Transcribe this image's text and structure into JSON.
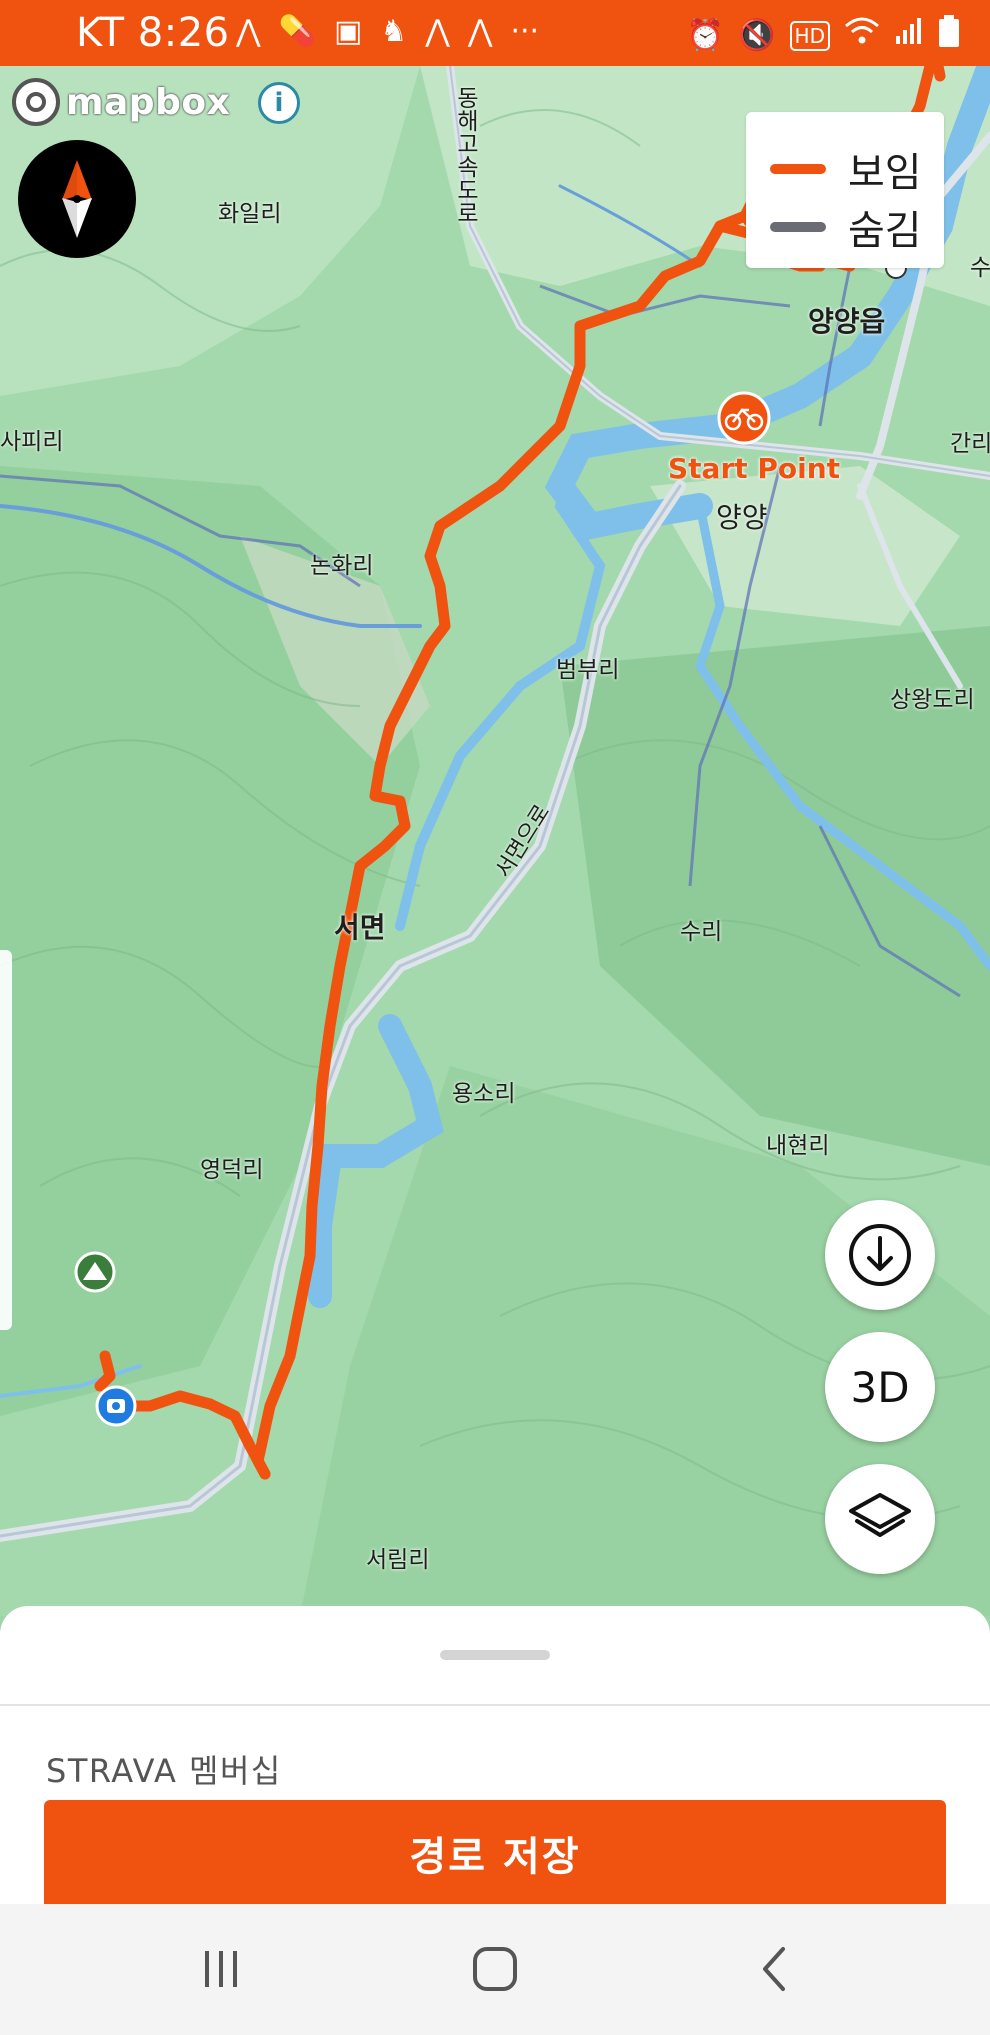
{
  "status_bar": {
    "time": "KT 8:26",
    "left_icons": [
      "strava-icon",
      "pill-icon",
      "shopping-icon",
      "app-icon",
      "strava-icon",
      "strava-icon",
      "more-dots-icon"
    ],
    "right_icons": [
      "alarm-icon",
      "mute-icon",
      "hd-icon",
      "wifi-icon",
      "signal-icon",
      "battery-icon"
    ],
    "more": "···"
  },
  "map": {
    "attribution": "mapbox",
    "info": "i",
    "start_label": "Start Point",
    "labels": [
      {
        "text": "화일리",
        "bold": false
      },
      {
        "text": "동해고속도로",
        "bold": false
      },
      {
        "text": "양양읍",
        "bold": true
      },
      {
        "text": "사피리",
        "bold": false
      },
      {
        "text": "간리",
        "bold": false
      },
      {
        "text": "양양",
        "bold": false
      },
      {
        "text": "논화리",
        "bold": false
      },
      {
        "text": "범부리",
        "bold": false
      },
      {
        "text": "상왕도리",
        "bold": false
      },
      {
        "text": "서면",
        "bold": true
      },
      {
        "text": "수리",
        "bold": false
      },
      {
        "text": "서면으로",
        "bold": false
      },
      {
        "text": "용소리",
        "bold": false
      },
      {
        "text": "내현리",
        "bold": false
      },
      {
        "text": "영덕리",
        "bold": false
      },
      {
        "text": "서림리",
        "bold": false
      },
      {
        "text": "수",
        "bold": false
      }
    ]
  },
  "legend": {
    "items": [
      {
        "label": "보임",
        "color": "#f0520f"
      },
      {
        "label": "숨김",
        "color": "#6b6b75"
      }
    ]
  },
  "controls": {
    "download_icon": "download-icon",
    "three_d_label": "3D",
    "layers_icon": "layers-icon"
  },
  "sheet": {
    "membership_label": "STRAVA 멤버십",
    "save_button_label": "경로 저장"
  },
  "nav": [
    "recent-apps-icon",
    "home-icon",
    "back-icon"
  ],
  "colors": {
    "accent": "#f0520f",
    "map_green": "#9fd4a8",
    "water": "#7ec0ea"
  }
}
